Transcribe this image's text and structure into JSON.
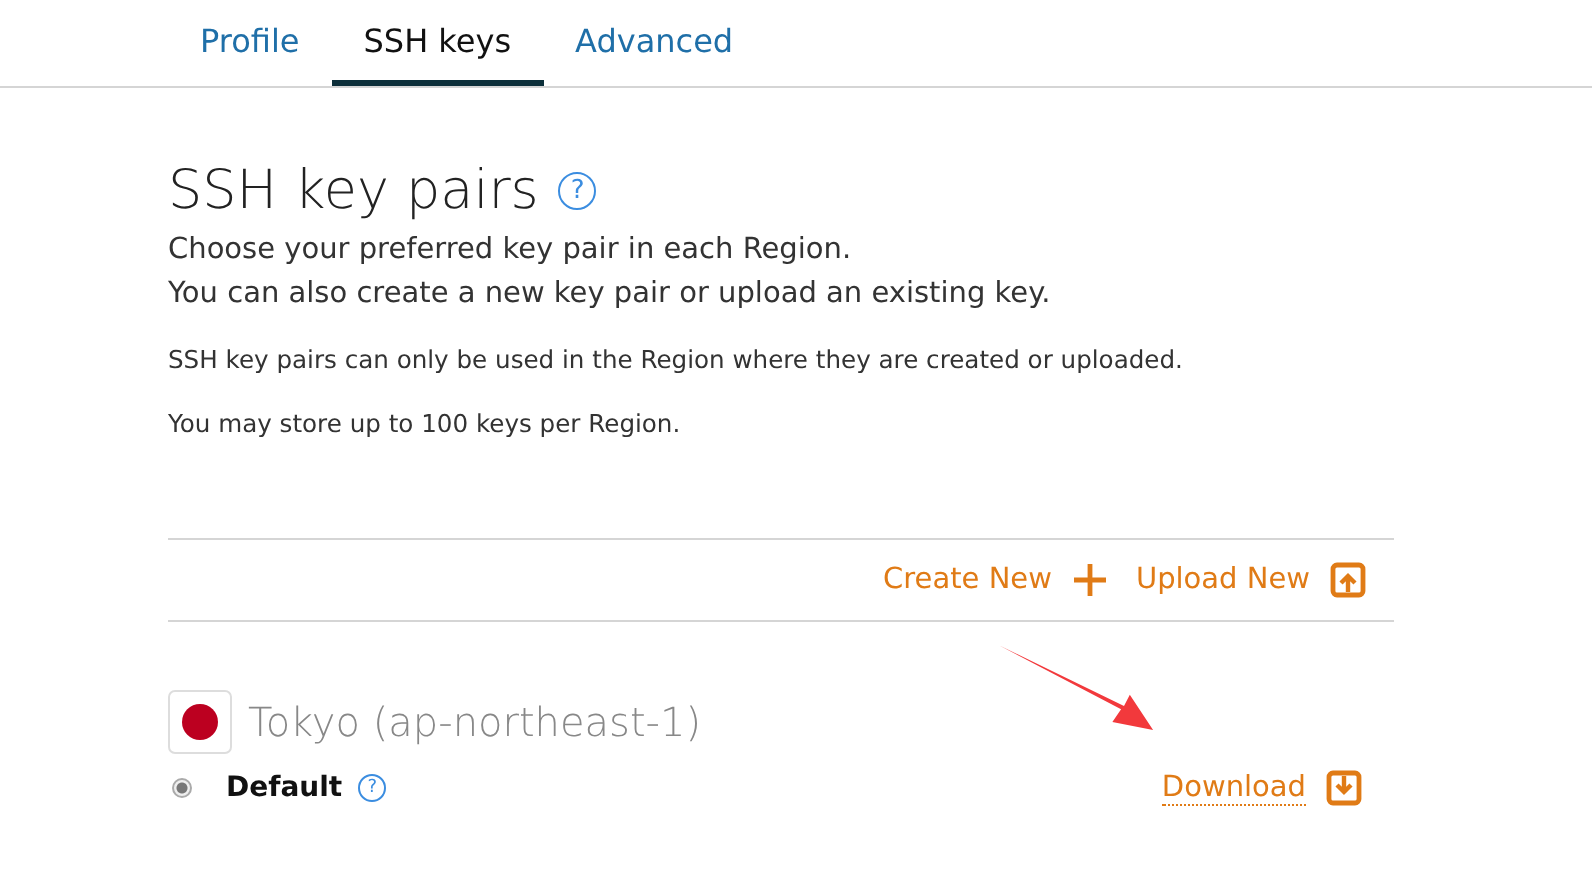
{
  "tabs": [
    {
      "label": "Profile",
      "selected": false
    },
    {
      "label": "SSH keys",
      "selected": true
    },
    {
      "label": "Advanced",
      "selected": false
    }
  ],
  "heading": {
    "title": "SSH key pairs",
    "help": "?"
  },
  "intro": [
    "Choose your preferred key pair in each Region.",
    "You can also create a new key pair or upload an existing key."
  ],
  "notes": [
    "SSH key pairs can only be used in the Region where they are created or uploaded.",
    "You may store up to 100 keys per Region."
  ],
  "actions": [
    {
      "label": "Create New",
      "kind": "create"
    },
    {
      "label": "Upload New",
      "kind": "upload"
    }
  ],
  "region": {
    "name": "Tokyo (ap-northeast-1)",
    "key": {
      "label": "Default",
      "help": "?",
      "selected": true
    },
    "download": "Download"
  }
}
